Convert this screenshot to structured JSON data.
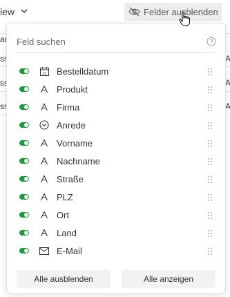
{
  "toolbar": {
    "view_label": "iew",
    "hide_fields_label": "Felder ausblenden"
  },
  "background_rows": {
    "left_fragments": [
      "ar",
      "ss",
      "ss",
      "ss"
    ],
    "right_fragments": [
      "A",
      "A",
      "A"
    ]
  },
  "popover": {
    "search_placeholder": "Feld suchen",
    "fields": [
      {
        "label": "Bestelldatum",
        "icon": "calendar-icon",
        "enabled": true
      },
      {
        "label": "Produkt",
        "icon": "text-type-icon",
        "enabled": true
      },
      {
        "label": "Firma",
        "icon": "text-type-icon",
        "enabled": true
      },
      {
        "label": "Anrede",
        "icon": "single-select-icon",
        "enabled": true
      },
      {
        "label": "Vorname",
        "icon": "text-type-icon",
        "enabled": true
      },
      {
        "label": "Nachname",
        "icon": "text-type-icon",
        "enabled": true
      },
      {
        "label": "Straße",
        "icon": "text-type-icon",
        "enabled": true
      },
      {
        "label": "PLZ",
        "icon": "text-type-icon",
        "enabled": true
      },
      {
        "label": "Ort",
        "icon": "text-type-icon",
        "enabled": true
      },
      {
        "label": "Land",
        "icon": "text-type-icon",
        "enabled": true
      },
      {
        "label": "E-Mail",
        "icon": "email-icon",
        "enabled": true
      }
    ],
    "hide_all_label": "Alle ausblenden",
    "show_all_label": "Alle anzeigen"
  },
  "colors": {
    "toggle_on": "#1a9e3a",
    "button_bg": "#ededed"
  }
}
